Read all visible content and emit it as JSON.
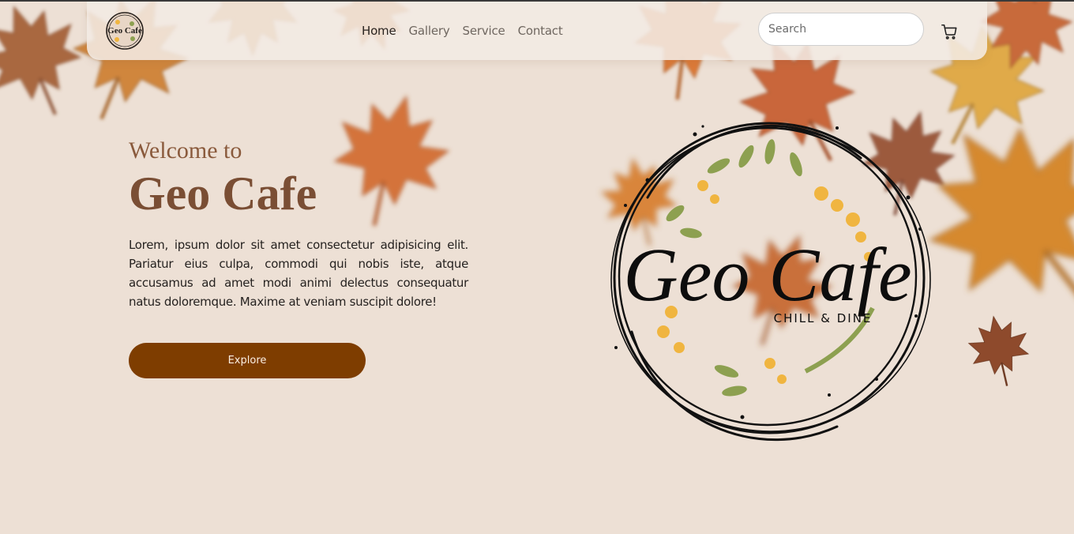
{
  "brand": {
    "logo_text": "Geo Cafe",
    "logo_tagline": "CHILL & DINE"
  },
  "nav": {
    "items": [
      {
        "label": "Home",
        "active": true
      },
      {
        "label": "Gallery",
        "active": false
      },
      {
        "label": "Service",
        "active": false
      },
      {
        "label": "Contact",
        "active": false
      }
    ],
    "search_placeholder": "Search",
    "cart_icon": "cart-icon"
  },
  "hero": {
    "welcome": "Welcome to",
    "title": "Geo Cafe",
    "body": "Lorem, ipsum dolor sit amet consectetur adipisicing elit. Pariatur eius culpa, commodi qui nobis iste, atque accusamus ad amet modi animi delectus consequatur natus doloremque. Maxime at veniam suscipit dolore!",
    "button_label": "Explore"
  },
  "colors": {
    "background": "#ede0d5",
    "accent": "#7e3d00",
    "heading": "#7a4e34",
    "leaf_orange": "#d9823a",
    "leaf_green": "#8da050",
    "flower_yellow": "#f0b540"
  }
}
